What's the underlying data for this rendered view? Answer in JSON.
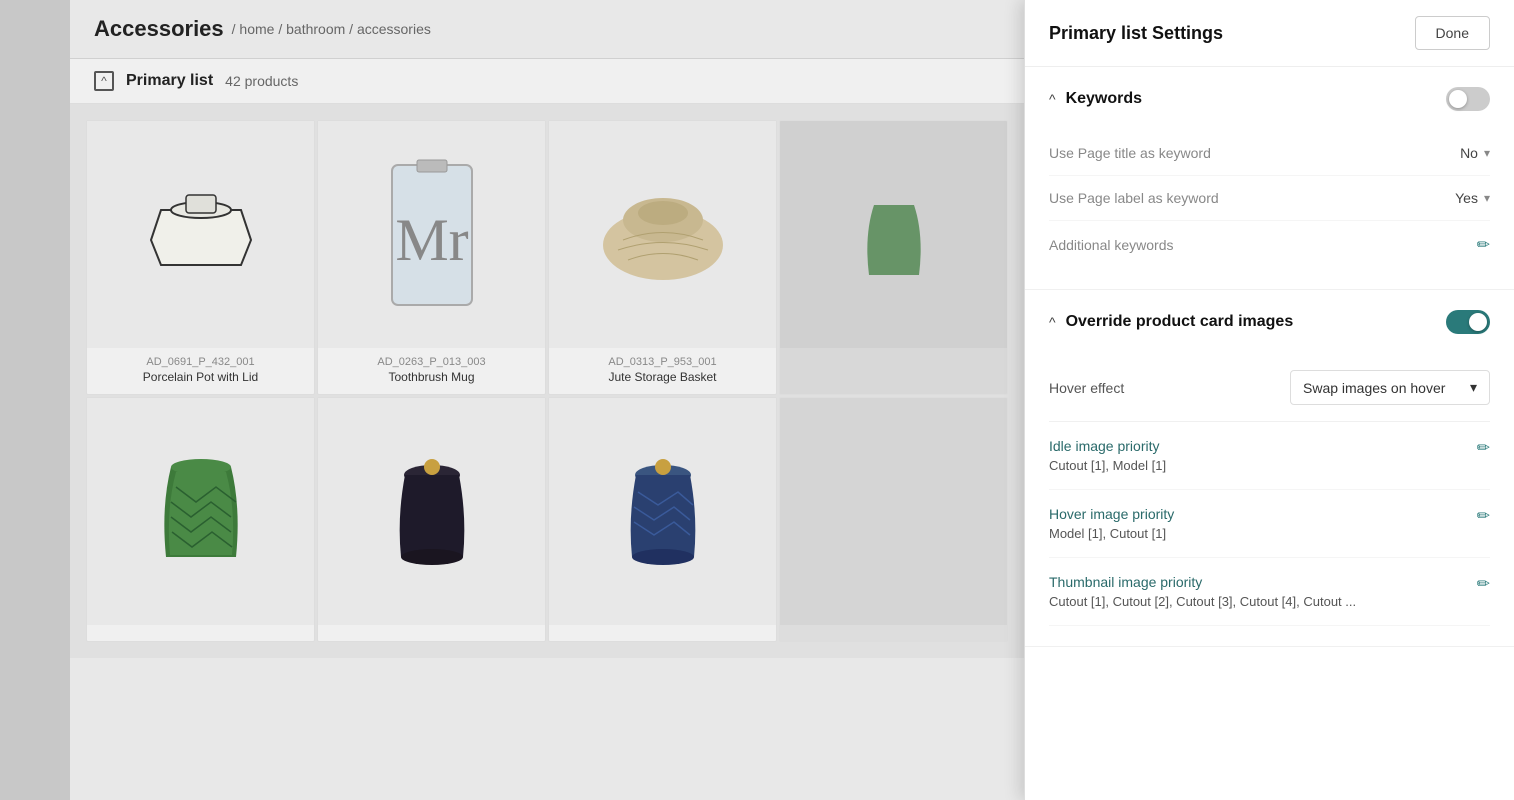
{
  "page": {
    "title": "Accessories",
    "breadcrumb": "/ home / bathroom / accessories"
  },
  "list": {
    "title": "Primary list",
    "count": "42 products"
  },
  "products": [
    {
      "sku": "AD_0691_P_432_001",
      "name": "Porcelain Pot with Lid",
      "type": "porcelain"
    },
    {
      "sku": "AD_0263_P_013_003",
      "name": "Toothbrush Mug",
      "type": "mug"
    },
    {
      "sku": "AD_0313_P_953_001",
      "name": "Jute Storage Basket",
      "type": "basket"
    },
    {
      "sku": "",
      "name": "",
      "type": "partial"
    },
    {
      "sku": "",
      "name": "",
      "type": "green-vase"
    },
    {
      "sku": "",
      "name": "",
      "type": "dark-jar"
    },
    {
      "sku": "",
      "name": "",
      "type": "blue-jar"
    }
  ],
  "settings": {
    "title": "Primary list Settings",
    "done_button": "Done",
    "keywords_section": {
      "title": "Keywords",
      "toggle_state": "off",
      "use_page_title": {
        "label": "Use Page title as keyword",
        "value": "No"
      },
      "use_page_label": {
        "label": "Use Page label as keyword",
        "value": "Yes"
      },
      "additional_keywords": {
        "label": "Additional keywords"
      }
    },
    "override_section": {
      "title": "Override product card images",
      "toggle_state": "on",
      "hover_effect": {
        "label": "Hover effect",
        "value": "Swap images on hover"
      },
      "idle_image": {
        "title": "Idle image priority",
        "value": "Cutout [1], Model [1]"
      },
      "hover_image": {
        "title": "Hover image priority",
        "value": "Model [1], Cutout [1]"
      },
      "thumbnail_image": {
        "title": "Thumbnail image priority",
        "value": "Cutout [1], Cutout [2], Cutout [3], Cutout [4], Cutout ..."
      }
    }
  }
}
